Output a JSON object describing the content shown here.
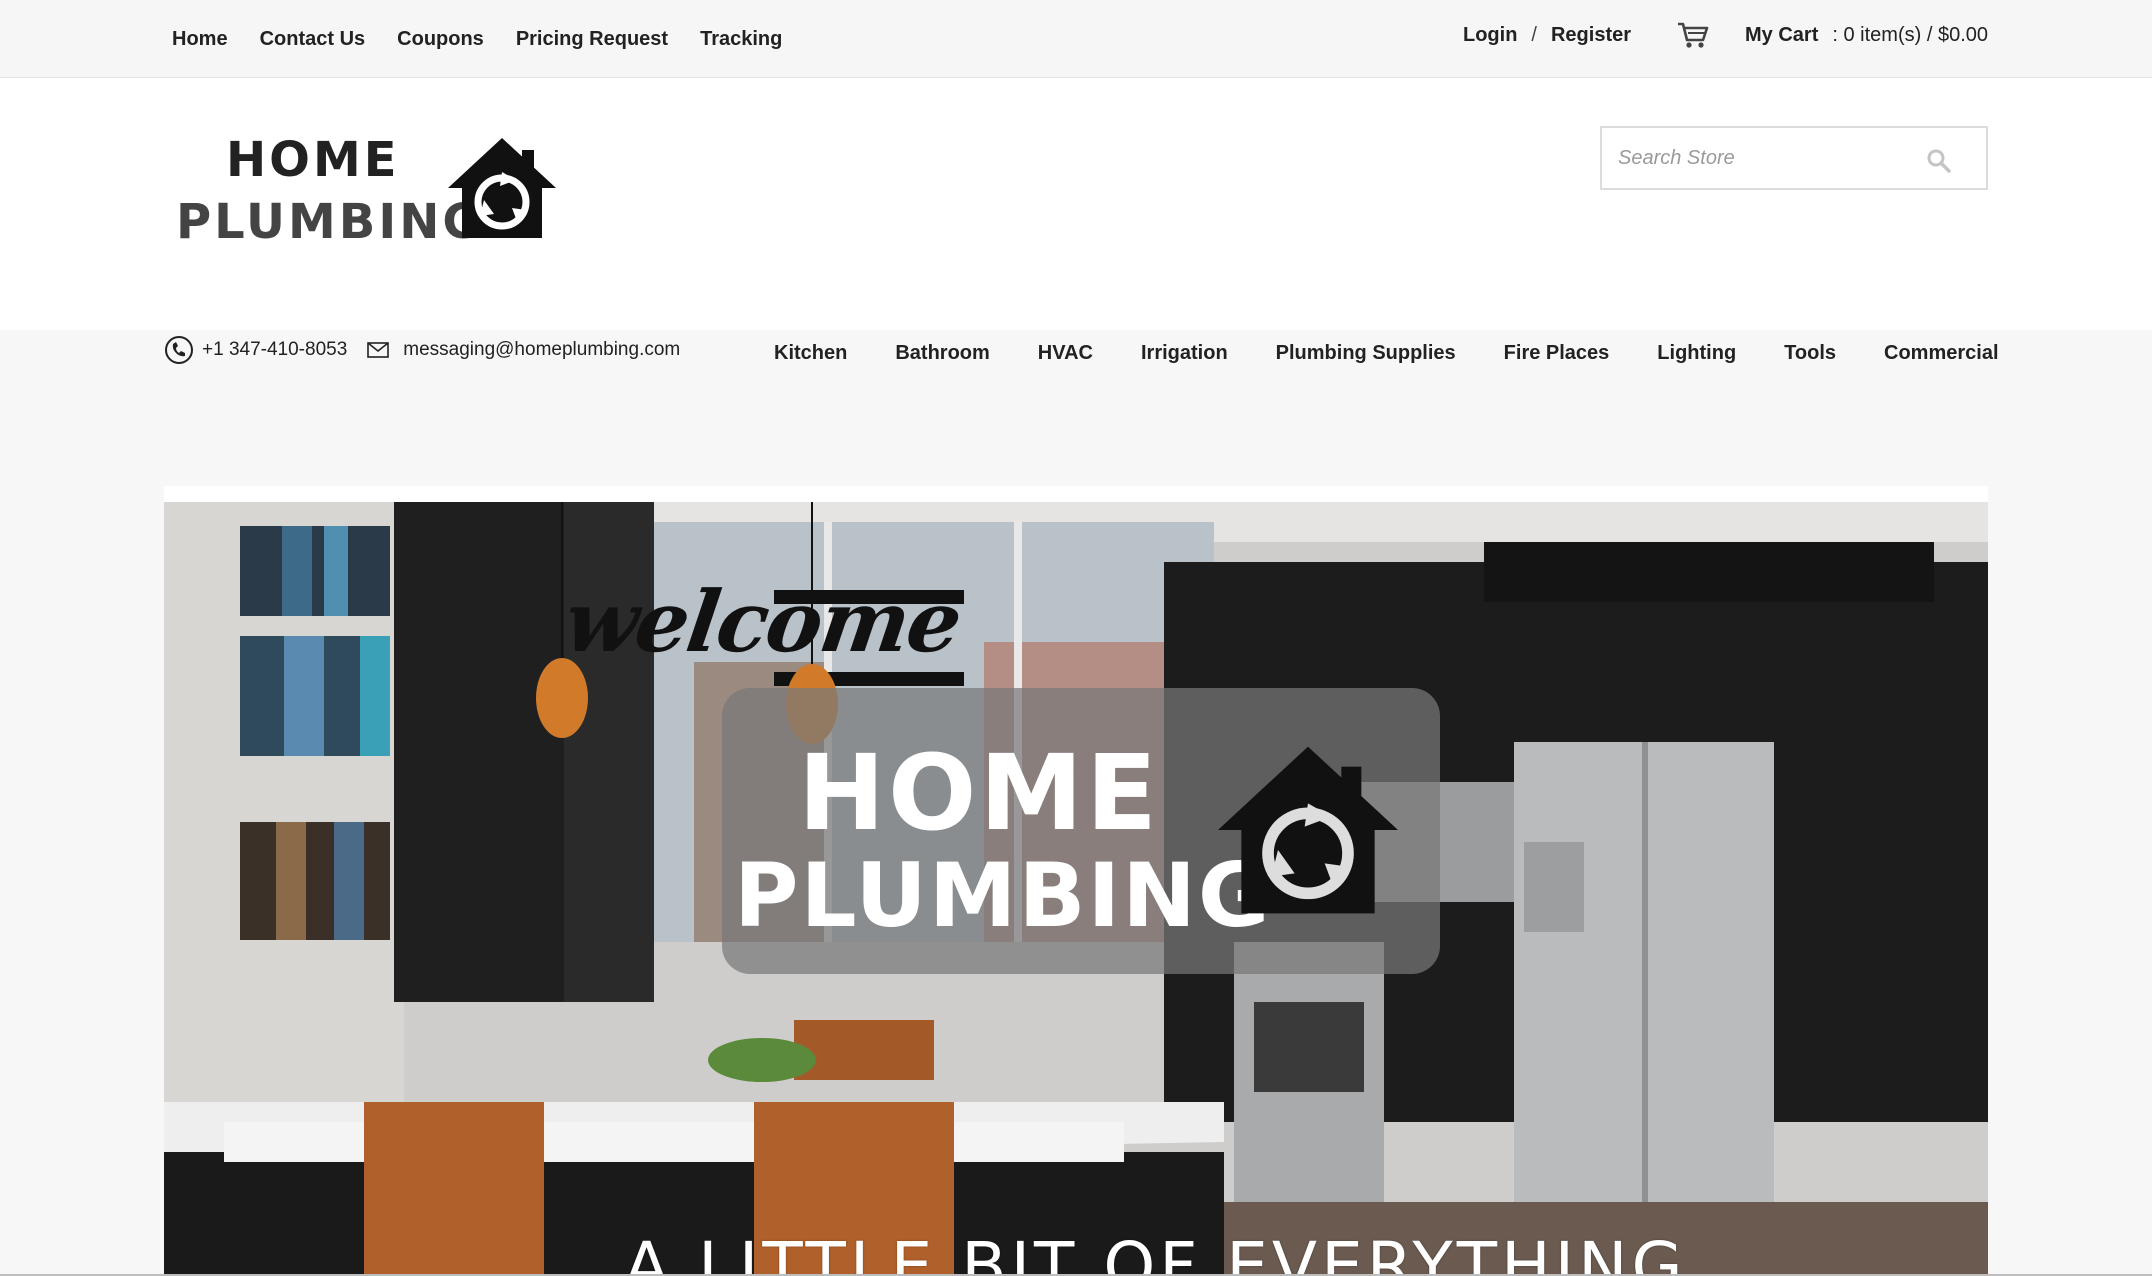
{
  "top_nav": {
    "items": [
      "Home",
      "Contact Us",
      "Coupons",
      "Pricing Request",
      "Tracking"
    ]
  },
  "account": {
    "login": "Login",
    "separator": "/",
    "register": "Register",
    "cart_label": "My Cart",
    "cart_summary": ": 0 item(s) / $0.00"
  },
  "logo": {
    "line1": "HOME",
    "line2": "PLUMBING"
  },
  "search": {
    "placeholder": "Search Store"
  },
  "contact": {
    "phone": "+1 347-410-8053",
    "email": "messaging@homeplumbing.com"
  },
  "categories": [
    "Kitchen",
    "Bathroom",
    "HVAC",
    "Irrigation",
    "Plumbing Supplies",
    "Fire Places",
    "Lighting",
    "Tools",
    "Commercial"
  ],
  "hero": {
    "welcome": "welcome",
    "title_line1": "HOME",
    "title_line2": "PLUMBING",
    "tagline": "A LITTLE BIT OF EVERYTHING"
  },
  "icons": {
    "cart": "cart-icon",
    "search": "search-icon",
    "phone": "phone-icon",
    "mail": "mail-icon",
    "logo": "house-recycle-icon"
  },
  "colors": {
    "topbar_bg": "#f6f6f6",
    "page_bg": "#f7f7f7",
    "text": "#222222"
  }
}
